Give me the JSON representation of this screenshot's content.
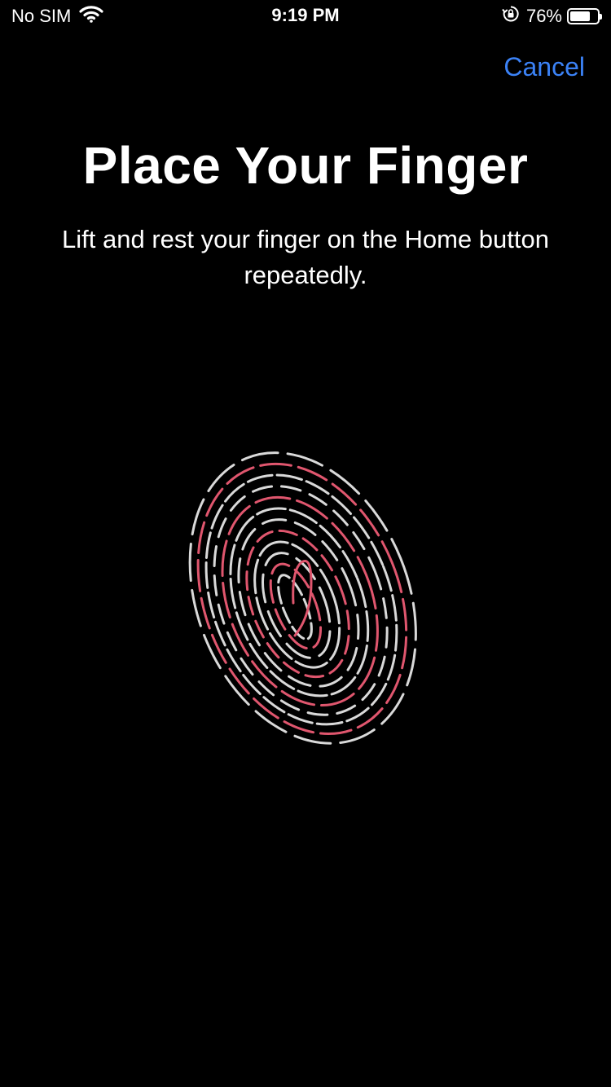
{
  "status_bar": {
    "carrier": "No SIM",
    "time": "9:19 PM",
    "battery_percent": "76%",
    "battery_level": 0.76,
    "icons": [
      "wifi-icon",
      "orientation-lock-icon",
      "battery-icon"
    ]
  },
  "nav": {
    "cancel_label": "Cancel"
  },
  "main": {
    "title": "Place Your Finger",
    "instructions": "Lift and rest your finger on the Home button repeatedly."
  },
  "fingerprint": {
    "icon": "fingerprint-icon",
    "ridge_color": "#d9d9d9",
    "progress_color": "#e0566e"
  },
  "colors": {
    "background": "#000000",
    "accent": "#3b82f6",
    "text": "#ffffff"
  }
}
